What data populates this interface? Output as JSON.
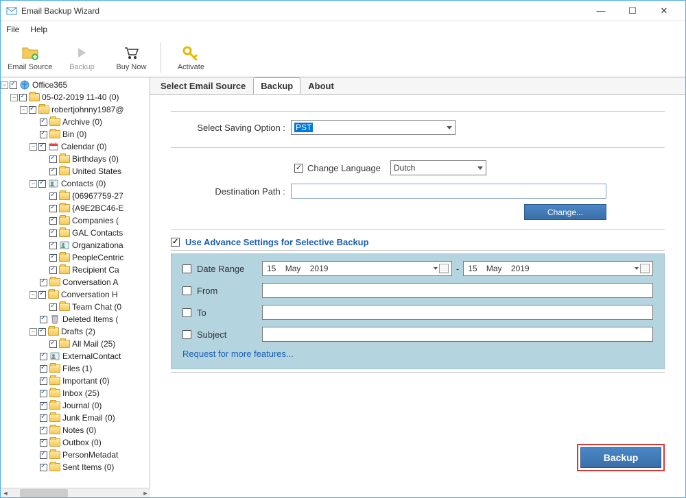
{
  "window": {
    "title": "Email Backup Wizard"
  },
  "menu": {
    "file": "File",
    "help": "Help"
  },
  "toolbar": {
    "email_source": "Email Source",
    "backup": "Backup",
    "buy_now": "Buy Now",
    "activate": "Activate"
  },
  "tabs": {
    "select_source": "Select Email Source",
    "backup": "Backup",
    "about": "About",
    "active": "backup"
  },
  "form": {
    "saving_label": "Select Saving Option :",
    "saving_value": "PST",
    "change_lang_label": "Change Language",
    "change_lang_checked": true,
    "lang_value": "Dutch",
    "dest_label": "Destination Path :",
    "dest_value": "",
    "change_btn": "Change..."
  },
  "advance": {
    "header": "Use Advance Settings for Selective Backup",
    "header_checked": true,
    "date_range_label": "Date Range",
    "date1_day": "15",
    "date1_mon": "May",
    "date1_year": "2019",
    "date2_day": "15",
    "date2_mon": "May",
    "date2_year": "2019",
    "from_label": "From",
    "to_label": "To",
    "subject_label": "Subject",
    "more_link": "Request for more features..."
  },
  "backup_button": "Backup",
  "tree": [
    {
      "indent": 0,
      "tw": "-",
      "label": "Office365",
      "icon": "world"
    },
    {
      "indent": 1,
      "tw": "-",
      "label": "05-02-2019 11-40 (0)"
    },
    {
      "indent": 2,
      "tw": "-",
      "label": "robertjohnny1987@"
    },
    {
      "indent": 3,
      "tw": " ",
      "label": "Archive (0)"
    },
    {
      "indent": 3,
      "tw": " ",
      "label": "Bin (0)"
    },
    {
      "indent": 3,
      "tw": "-",
      "label": "Calendar (0)",
      "icon": "cal"
    },
    {
      "indent": 4,
      "tw": " ",
      "label": "Birthdays (0)"
    },
    {
      "indent": 4,
      "tw": " ",
      "label": "United States"
    },
    {
      "indent": 3,
      "tw": "-",
      "label": "Contacts (0)",
      "icon": "contact"
    },
    {
      "indent": 4,
      "tw": " ",
      "label": "{06967759-27"
    },
    {
      "indent": 4,
      "tw": " ",
      "label": "{A9E2BC46-E"
    },
    {
      "indent": 4,
      "tw": " ",
      "label": "Companies ("
    },
    {
      "indent": 4,
      "tw": " ",
      "label": "GAL Contacts"
    },
    {
      "indent": 4,
      "tw": " ",
      "label": "Organizationa",
      "icon": "contact"
    },
    {
      "indent": 4,
      "tw": " ",
      "label": "PeopleCentric"
    },
    {
      "indent": 4,
      "tw": " ",
      "label": "Recipient Ca"
    },
    {
      "indent": 3,
      "tw": " ",
      "label": "Conversation A"
    },
    {
      "indent": 3,
      "tw": "-",
      "label": "Conversation H"
    },
    {
      "indent": 4,
      "tw": " ",
      "label": "Team Chat (0"
    },
    {
      "indent": 3,
      "tw": " ",
      "label": "Deleted Items (",
      "icon": "del"
    },
    {
      "indent": 3,
      "tw": "-",
      "label": "Drafts (2)"
    },
    {
      "indent": 4,
      "tw": " ",
      "label": "All Mail (25)"
    },
    {
      "indent": 3,
      "tw": " ",
      "label": "ExternalContact",
      "icon": "contact"
    },
    {
      "indent": 3,
      "tw": " ",
      "label": "Files (1)"
    },
    {
      "indent": 3,
      "tw": " ",
      "label": "Important (0)"
    },
    {
      "indent": 3,
      "tw": " ",
      "label": "Inbox (25)"
    },
    {
      "indent": 3,
      "tw": " ",
      "label": "Journal (0)"
    },
    {
      "indent": 3,
      "tw": " ",
      "label": "Junk Email (0)"
    },
    {
      "indent": 3,
      "tw": " ",
      "label": "Notes (0)"
    },
    {
      "indent": 3,
      "tw": " ",
      "label": "Outbox (0)"
    },
    {
      "indent": 3,
      "tw": " ",
      "label": "PersonMetadat"
    },
    {
      "indent": 3,
      "tw": " ",
      "label": "Sent Items (0)"
    }
  ]
}
